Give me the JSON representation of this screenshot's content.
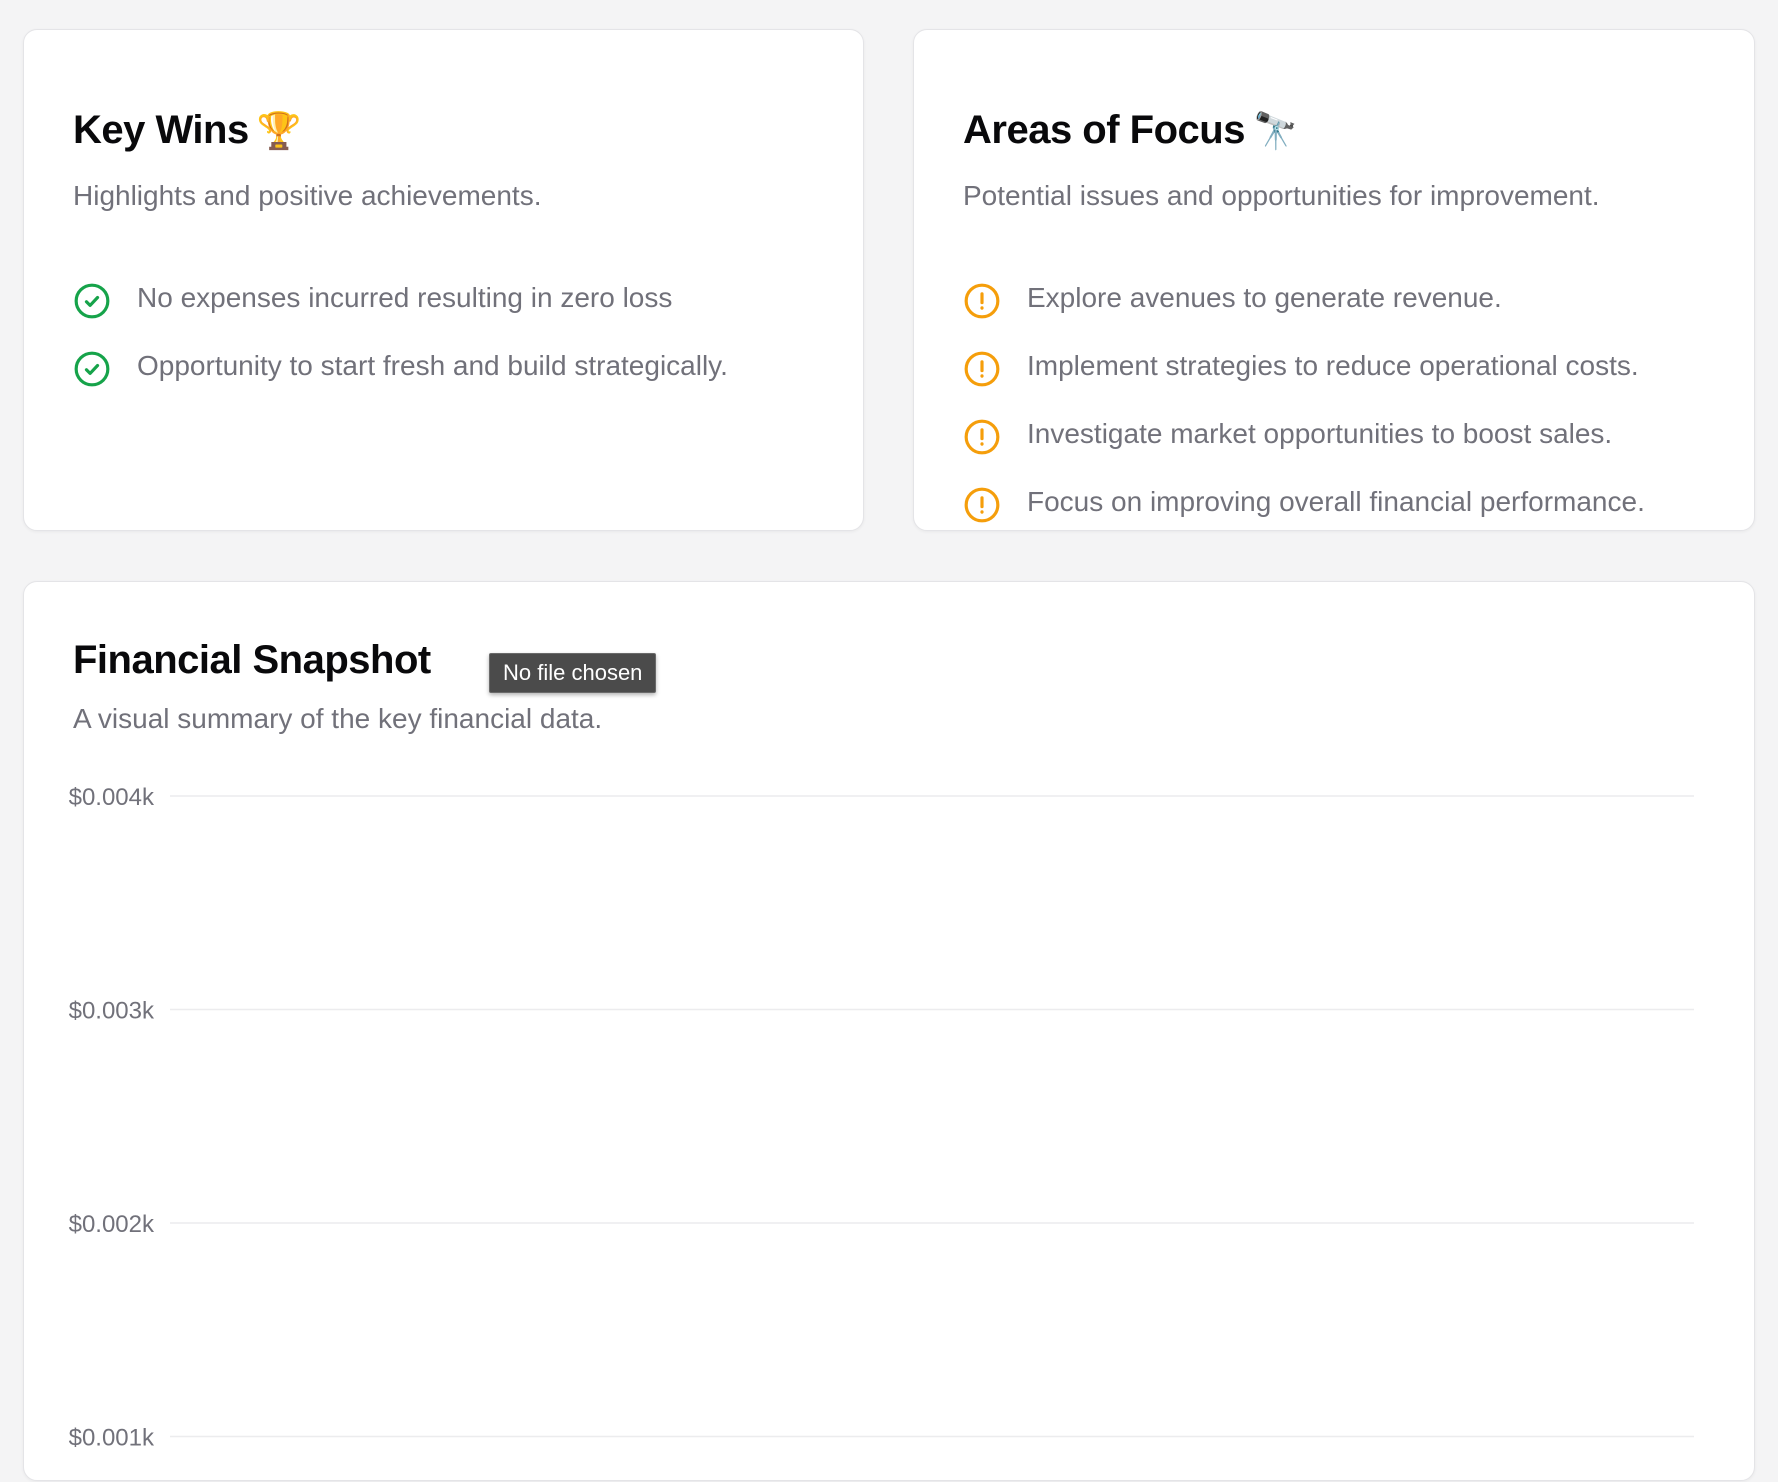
{
  "key_wins": {
    "title": "Key Wins",
    "emoji": "🏆",
    "subtitle": "Highlights and positive achievements.",
    "items": [
      "No expenses incurred resulting in zero loss",
      "Opportunity to start fresh and build strategically."
    ]
  },
  "areas_of_focus": {
    "title": "Areas of Focus",
    "emoji": "🔭",
    "subtitle": "Potential issues and opportunities for improvement.",
    "items": [
      "Explore avenues to generate revenue.",
      "Implement strategies to reduce operational costs.",
      "Investigate market opportunities to boost sales.",
      "Focus on improving overall financial performance."
    ]
  },
  "financial_snapshot": {
    "title": "Financial Snapshot",
    "subtitle": "A visual summary of the key financial data."
  },
  "tooltip": {
    "text": "No file chosen"
  },
  "colors": {
    "success": "#16a34a",
    "warning": "#f59e0b"
  },
  "chart_data": {
    "type": "bar",
    "categories": [],
    "series": [],
    "yticks": [
      "$0.004k",
      "$0.003k",
      "$0.002k",
      "$0.001k"
    ],
    "ytick_values": [
      0.004,
      0.003,
      0.002,
      0.001
    ],
    "ylim": [
      0,
      0.004
    ],
    "grid": true
  }
}
